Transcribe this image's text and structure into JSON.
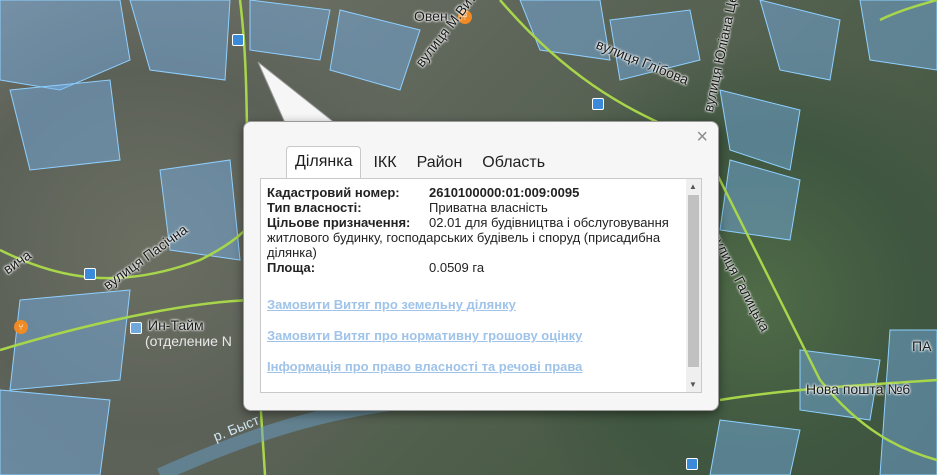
{
  "map": {
    "labels": [
      {
        "text": "Овен"
      },
      {
        "text": "вулиця М.Витвицького"
      },
      {
        "text": "вулиця Глібова"
      },
      {
        "text": "вулиця Юліана Целевича"
      },
      {
        "text": "вулиця Пасічна"
      },
      {
        "text": "вулиця Галицька"
      },
      {
        "text": "Ин-Тайм"
      },
      {
        "text": "(отделение N"
      },
      {
        "text": "Нова пошта №6"
      },
      {
        "text": "р. Быст"
      },
      {
        "text": "ПА"
      },
      {
        "text": "вича"
      }
    ],
    "poi_icon": "restaurant-icon"
  },
  "popup": {
    "close_label": "×",
    "tabs": [
      {
        "label": "Ділянка",
        "active": true
      },
      {
        "label": "ІКК",
        "active": false
      },
      {
        "label": "Район",
        "active": false
      },
      {
        "label": "Область",
        "active": false
      }
    ],
    "fields": [
      {
        "key": "Кадастровий номер:",
        "value": "2610100000:01:009:0095",
        "bold": true
      },
      {
        "key": "Тип власності:",
        "value": "Приватна власність"
      },
      {
        "key": "Цільове призначення:",
        "value": "02.01 для будівництва і обслуговування житлового будинку, господарських будівель і споруд (присадибна ділянка)"
      },
      {
        "key": "Площа:",
        "value": "0.0509 га"
      }
    ],
    "links": [
      "Замовити Витяг про земельну ділянку",
      "Замовити Витяг про нормативну грошову оцінку",
      "Інформація про право власності та речові права"
    ],
    "scroll_up": "▲",
    "scroll_down": "▼"
  }
}
